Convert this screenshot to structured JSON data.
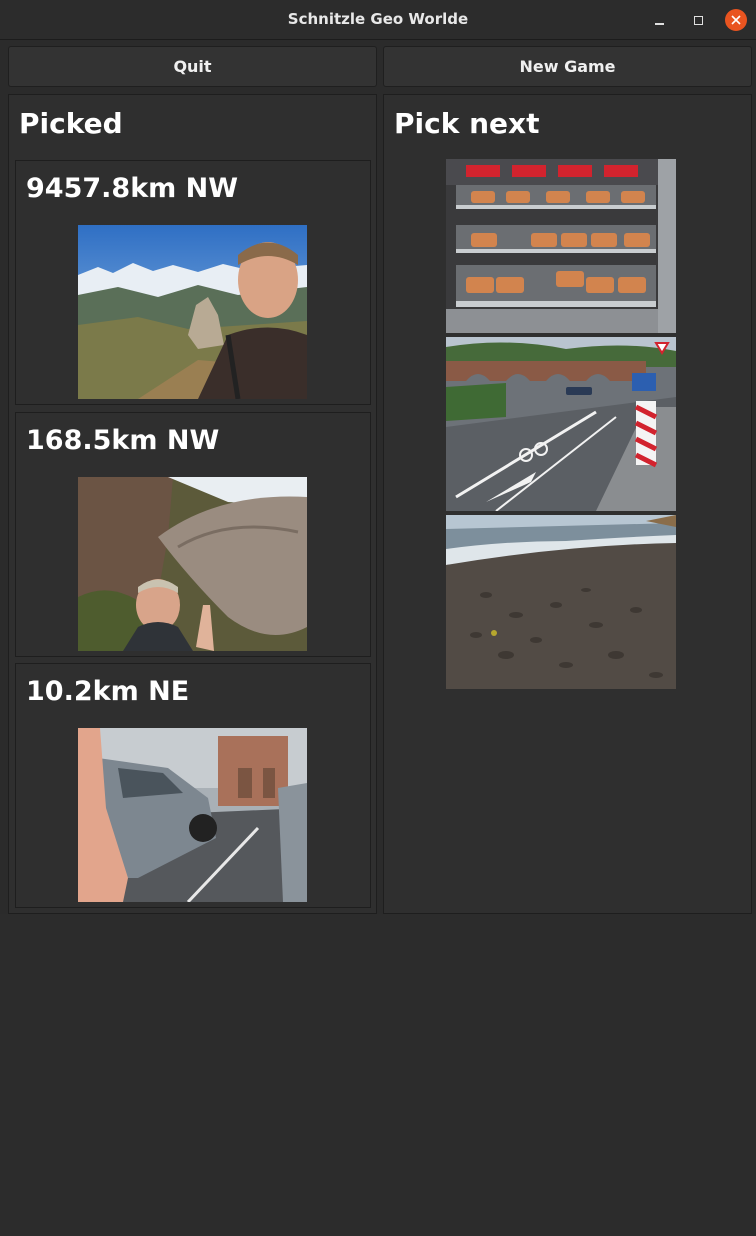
{
  "window": {
    "title": "Schnitzle Geo Worlde"
  },
  "toolbar": {
    "quit_label": "Quit",
    "new_game_label": "New Game"
  },
  "picked": {
    "heading": "Picked",
    "items": [
      {
        "distance": "9457.8km NW",
        "photo": "mountain-selfie-photo"
      },
      {
        "distance": "168.5km NW",
        "photo": "boulder-selfie-photo"
      },
      {
        "distance": "10.2km NE",
        "photo": "parked-car-photo"
      }
    ]
  },
  "pick_next": {
    "heading": "Pick next",
    "options": [
      {
        "photo": "hot-food-counter-photo"
      },
      {
        "photo": "bridge-street-photo"
      },
      {
        "photo": "black-sand-beach-photo"
      }
    ]
  },
  "colors": {
    "close_button": "#e95420",
    "background": "#2b2b2b",
    "panel": "#2f2f2f"
  }
}
